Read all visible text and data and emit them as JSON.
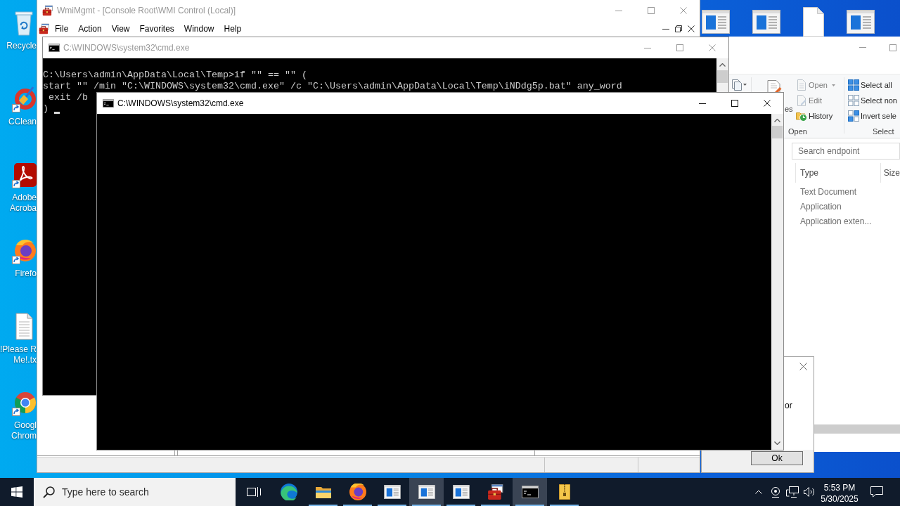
{
  "desktop_icons": [
    {
      "kind": "bin",
      "label_lines": [
        "Recycle"
      ],
      "shortcut": false
    },
    {
      "kind": "cleaner",
      "label_lines": [
        "CClean"
      ],
      "shortcut": true
    },
    {
      "kind": "pdf",
      "label_lines": [
        "Adobe",
        "Acroba"
      ],
      "shortcut": true
    },
    {
      "kind": "firefox",
      "label_lines": [
        "Firefo"
      ],
      "shortcut": true
    },
    {
      "kind": "textfile",
      "label_lines": [
        "!Please R",
        "Me!.tx"
      ],
      "shortcut": false
    },
    {
      "kind": "chrome",
      "label_lines": [
        "Googl",
        "Chrom"
      ],
      "shortcut": true
    }
  ],
  "desktop_icons_top": [
    {
      "kind": "window"
    },
    {
      "kind": "window"
    },
    {
      "kind": "page"
    },
    {
      "kind": "window"
    }
  ],
  "explorer_window": {
    "active": false,
    "ribbon": {
      "groups": [
        {
          "label": "Open",
          "large_button": {
            "label": "es"
          },
          "items": [
            {
              "kind": "open",
              "label": "Open",
              "dropdown": true,
              "disabled": true
            },
            {
              "kind": "edit",
              "label": "Edit",
              "dropdown": false,
              "disabled": true
            },
            {
              "kind": "history",
              "label": "History",
              "dropdown": false,
              "disabled": false
            }
          ]
        },
        {
          "label": "Select",
          "items": [
            {
              "kind": "all",
              "label": "Select all",
              "dropdown": false,
              "disabled": false
            },
            {
              "kind": "none",
              "label": "Select non",
              "dropdown": false,
              "disabled": false
            },
            {
              "kind": "invert",
              "label": "Invert sele",
              "dropdown": false,
              "disabled": false
            }
          ]
        }
      ]
    },
    "search": {
      "placeholder": "Search endpoint"
    },
    "columns": [
      "Type",
      "Size"
    ],
    "rows": [
      {
        "type": "Text Document"
      },
      {
        "type": "Application"
      },
      {
        "type": "Application exten..."
      }
    ]
  },
  "message_dialog": {
    "text": "or",
    "button": "Ok"
  },
  "wmi_window": {
    "title": "WmiMgmt - [Console Root\\WMI Control (Local)]",
    "active": false,
    "menu": [
      "File",
      "Action",
      "View",
      "Favorites",
      "Window",
      "Help"
    ]
  },
  "console_windows": [
    {
      "title": "C:\\WINDOWS\\system32\\cmd.exe",
      "active": false,
      "lines": [
        "C:\\Users\\admin\\AppData\\Local\\Temp>if \"\" == \"\" (",
        "start \"\" /min \"C:\\WINDOWS\\system32\\cmd.exe\" /c \"C:\\Users\\admin\\AppData\\Local\\Temp\\iNDdg5p.bat\" any_word",
        " exit /b",
        ")"
      ],
      "cursor": true
    },
    {
      "title": "C:\\WINDOWS\\system32\\cmd.exe",
      "active": true,
      "cursor": false
    }
  ],
  "taskbar": {
    "search": {
      "placeholder": "Type here to search"
    },
    "apps": [
      {
        "kind": "edge",
        "running": false,
        "selected": false
      },
      {
        "kind": "explorer",
        "running": true,
        "selected": false
      },
      {
        "kind": "firefox",
        "running": true,
        "selected": false
      },
      {
        "kind": "window",
        "running": true,
        "selected": false
      },
      {
        "kind": "window",
        "running": true,
        "selected": true
      },
      {
        "kind": "window",
        "running": true,
        "selected": false
      },
      {
        "kind": "toolbox",
        "running": true,
        "selected": false
      },
      {
        "kind": "console",
        "running": true,
        "selected": true
      },
      {
        "kind": "archive",
        "running": true,
        "selected": false
      }
    ],
    "clock": {
      "time": "5:53 PM",
      "date": "5/30/2025"
    }
  }
}
